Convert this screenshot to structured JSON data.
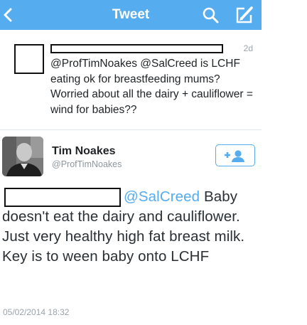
{
  "header": {
    "title": "Tweet",
    "back_icon": "chevron-left-icon",
    "search_icon": "search-icon",
    "compose_icon": "compose-icon",
    "bar_color": "#55acee"
  },
  "parent_tweet": {
    "time": "2d",
    "text": "@ProfTimNoakes @SalCreed is LCHF eating ok for breastfeeding mums? Worried about all the dairy + cauliflower = wind for babies??"
  },
  "main_tweet": {
    "author_name": "Tim Noakes",
    "author_handle": "@ProfTimNoakes",
    "follow_icon": "add-user-icon",
    "mention": "@SalCreed",
    "text": " Baby doesn't eat the dairy and cauliflower. Just very healthy high fat breast milk. Key is to ween baby onto LCHF",
    "date": "05/02/2014 18:32"
  }
}
